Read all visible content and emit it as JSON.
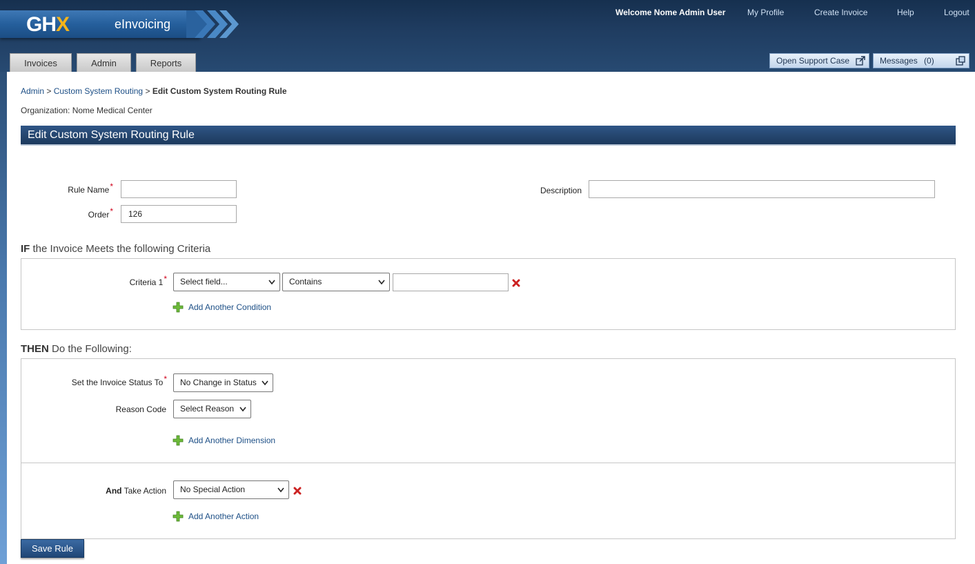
{
  "header": {
    "logo_main": "GH",
    "logo_accent": "X",
    "product": "eInvoicing",
    "welcome": "Welcome Nome Admin User",
    "links": [
      "My Profile",
      "Create Invoice",
      "Help",
      "Logout"
    ],
    "tabs": [
      "Invoices",
      "Admin",
      "Reports"
    ],
    "support_button": "Open Support Case",
    "messages_label": "Messages",
    "messages_count": "(0)"
  },
  "breadcrumb": {
    "admin": "Admin",
    "sep1": ">",
    "routing": "Custom System Routing",
    "sep2": ">",
    "current": "Edit Custom System Routing Rule"
  },
  "organization": "Organization: Nome Medical Center",
  "page_title": "Edit Custom System Routing Rule",
  "form": {
    "rule_name_label": "Rule Name",
    "rule_name_value": "",
    "order_label": "Order",
    "order_value": "126",
    "description_label": "Description",
    "description_value": "",
    "required_mark": "*"
  },
  "if_section": {
    "heading_bold": "IF",
    "heading_rest": " the Invoice Meets the following Criteria",
    "criteria_label": "Criteria 1",
    "field_select": "Select field...",
    "operator_select": "Contains",
    "value": "",
    "add_condition": "Add Another Condition"
  },
  "then_section": {
    "heading_bold": "THEN",
    "heading_rest": " Do the Following:",
    "status_label": "Set the Invoice Status To",
    "status_select": "No Change in Status",
    "reason_label": "Reason Code",
    "reason_select": "Select Reason",
    "add_dimension": "Add Another Dimension",
    "action_label_bold": "And",
    "action_label_rest": " Take Action",
    "action_select": "No Special Action",
    "add_action": "Add Another Action"
  },
  "save_button": "Save Rule",
  "colors": {
    "header_dark": "#1f3c60",
    "accent_gold": "#f4b41a",
    "link_blue": "#1d4f86",
    "required_red": "#d0021b",
    "delete_red": "#cc2222",
    "add_green": "#6dbb3a"
  }
}
